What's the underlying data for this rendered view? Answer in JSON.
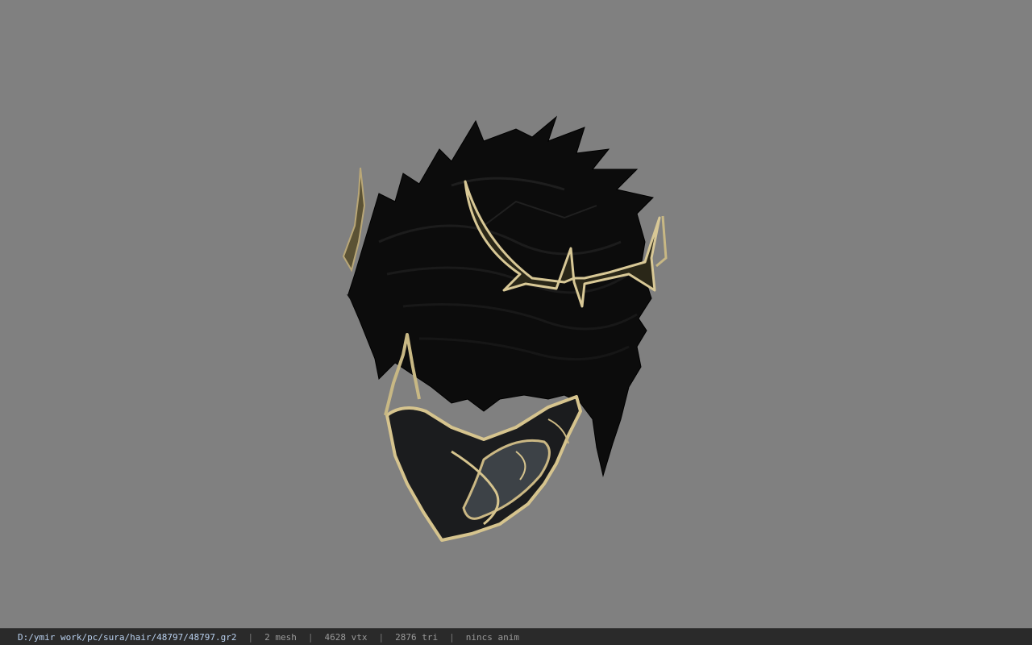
{
  "viewer": {
    "background_color": "#808080",
    "model_preview": "sura hair model with gold crown and face mask"
  },
  "status": {
    "file_path": "D:/ymir work/pc/sura/hair/48797/48797.gr2",
    "separator": "|",
    "mesh_count": "2 mesh",
    "vertex_count": "4628 vtx",
    "triangle_count": "2876 tri",
    "anim_status": "nincs anim"
  }
}
